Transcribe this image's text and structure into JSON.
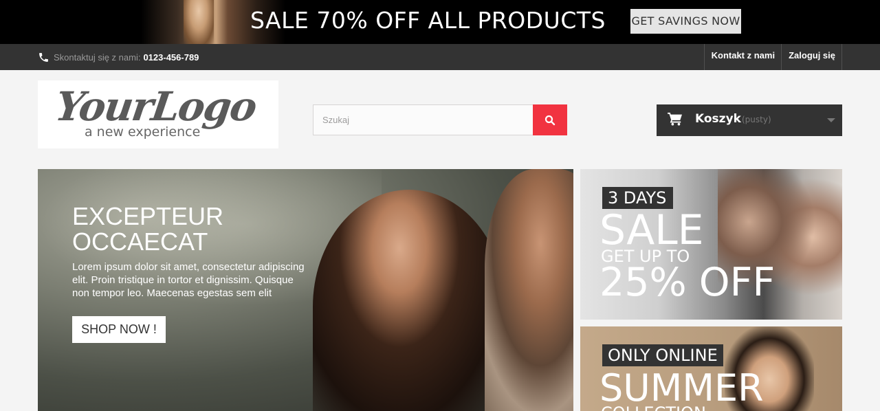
{
  "promo": {
    "text": "SALE 70% OFF ALL PRODUCTS",
    "button_label": "GET SAVINGS NOW"
  },
  "nav": {
    "contact_label": "Skontaktuj się z nami:",
    "phone": "0123-456-789",
    "links": [
      "Kontakt z nami",
      "Zaloguj się"
    ]
  },
  "header": {
    "logo_main": "YourLogo",
    "logo_sub": "a new experience",
    "search_placeholder": "Szukaj",
    "cart_label": "Koszyk",
    "cart_status": "(pusty)"
  },
  "hero": {
    "title": "EXCEPTEUR OCCAECAT",
    "text": "Lorem ipsum dolor sit amet, consectetur adipiscing elit. Proin tristique in tortor et dignissim. Quisque non tempor leo. Maecenas egestas sem elit",
    "button_label": "SHOP NOW !"
  },
  "banners": [
    {
      "tag": "3 DAYS",
      "line1": "SALE",
      "line2": "GET UP TO",
      "line3": "25% OFF"
    },
    {
      "tag": "ONLY ONLINE",
      "line1": "SUMMER",
      "line2": "COLLECTION"
    }
  ],
  "colors": {
    "accent": "#f13340",
    "dark": "#333333",
    "background": "#f4f4f4"
  },
  "icons": [
    "phone-icon",
    "search-icon",
    "cart-icon",
    "chevron-down-icon"
  ]
}
